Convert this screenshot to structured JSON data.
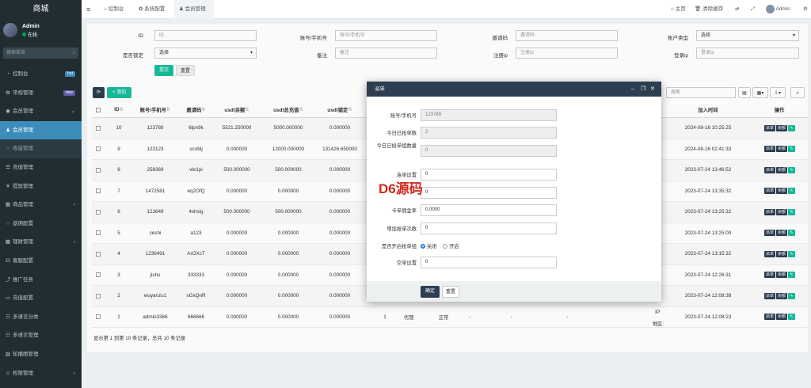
{
  "sidebar": {
    "brand": "商城",
    "user_name": "Admin",
    "status": "在线",
    "search_placeholder": "搜索菜单",
    "items": [
      {
        "label": "控制台",
        "icon": "dashboard-icon",
        "badge": "hot",
        "badge_color": "#3c8dbc"
      },
      {
        "label": "常规管理",
        "icon": "cog-icon",
        "badge": "new",
        "badge_color": "#605ca8"
      },
      {
        "label": "会员管理",
        "icon": "user-circle-icon",
        "arrow": "⌄"
      },
      {
        "label": "会员管理",
        "icon": "user-icon",
        "active": true
      },
      {
        "label": "收益管理",
        "icon": "circle-icon",
        "sub": true
      },
      {
        "label": "充值管理",
        "icon": "list-icon"
      },
      {
        "label": "提现管理",
        "icon": "yen-icon"
      },
      {
        "label": "商品管理",
        "icon": "table-icon",
        "arrow": "‹"
      },
      {
        "label": "返佣配置",
        "icon": "circle-icon"
      },
      {
        "label": "理财管理",
        "icon": "th-icon",
        "arrow": "‹"
      },
      {
        "label": "客服配置",
        "icon": "headset-icon"
      },
      {
        "label": "推广任务",
        "icon": "share-icon"
      },
      {
        "label": "充值配置",
        "icon": "card-icon"
      },
      {
        "label": "多语言分类",
        "icon": "language-icon"
      },
      {
        "label": "多语言管理",
        "icon": "language-icon"
      },
      {
        "label": "轮播图管理",
        "icon": "image-icon"
      },
      {
        "label": "权限管理",
        "icon": "group-icon",
        "arrow": "‹"
      }
    ]
  },
  "topbar": {
    "tabs": [
      "控制台",
      "系统配置",
      "会员管理"
    ],
    "right": [
      "主页",
      "清除缓存",
      "Admin"
    ]
  },
  "filters": {
    "id_label": "ID",
    "id_ph": "ID",
    "account_label": "账号/手机号",
    "account_ph": "账号/手机号",
    "invite_label": "邀请码",
    "invite_ph": "邀请码",
    "type_label": "账户类型",
    "type_value": "选择",
    "lock_label": "是否锁定",
    "lock_value": "选择",
    "remark_label": "备注",
    "remark_ph": "备注",
    "regip_label": "注册ip",
    "regip_ph": "注册ip",
    "loginip_label": "登录ip",
    "loginip_ph": "登录ip",
    "submit": "提交",
    "reset": "重置"
  },
  "toolbar": {
    "add": "添加",
    "search_ph": "搜索"
  },
  "table": {
    "headers": [
      "ID",
      "账号/手机号",
      "邀请码",
      "usdt余额",
      "usdt总充值",
      "usdt锁定",
      "加入时间",
      "操作"
    ],
    "rows": [
      {
        "id": "10",
        "acct": "123789",
        "inv": "6lpn9k",
        "bal": "5521.250000",
        "rech": "5000.000000",
        "lock": "0.000000",
        "time": "2024-08-16 10:25:25"
      },
      {
        "id": "9",
        "acct": "123123",
        "inv": "scofdj",
        "bal": "0.000000",
        "rech": "12000.000000",
        "lock": "131426.650000",
        "time": "2024-08-16 02:41:33"
      },
      {
        "id": "8",
        "acct": "258369",
        "inv": "vle1pi",
        "bal": "500.000000",
        "rech": "500.000000",
        "lock": "0.000000",
        "time": "2023-07-24 13:46:52"
      },
      {
        "id": "7",
        "acct": "1472581",
        "inv": "eq2OfQ",
        "bal": "0.000000",
        "rech": "0.000000",
        "lock": "0.000000",
        "time": "2023-07-24 13:35:32"
      },
      {
        "id": "6",
        "acct": "123649",
        "inv": "4xhsig",
        "bal": "500.000000",
        "rech": "500.000000",
        "lock": "0.000000",
        "time": "2023-07-24 13:25:32"
      },
      {
        "id": "5",
        "acct": "ceshi",
        "inv": "a123",
        "bal": "0.000000",
        "rech": "0.000000",
        "lock": "0.000000",
        "time": "2023-07-24 13:25:00"
      },
      {
        "id": "4",
        "acct": "1236491",
        "inv": "ArOXcT",
        "bal": "0.000000",
        "rech": "0.000000",
        "lock": "0.000000",
        "time": "2023-07-24 13:15:32"
      },
      {
        "id": "3",
        "acct": "jishu",
        "inv": "333333",
        "bal": "0.000000",
        "rech": "0.000000",
        "lock": "0.000000",
        "time": "2023-07-24 12:26:31"
      },
      {
        "id": "2",
        "acct": "wuyanzu1",
        "inv": "sGxQnR",
        "bal": "0.000000",
        "rech": "0.000000",
        "lock": "0.000000",
        "time": "2023-07-24 12:08:38"
      },
      {
        "id": "1",
        "acct": "admin3366",
        "inv": "666666",
        "bal": "0.000000",
        "rech": "0.000000",
        "lock": "0.000000",
        "time": "2023-07-24 12:08:23"
      }
    ],
    "last_row_extra": {
      "level": "1",
      "role": "代理",
      "status": "正常",
      "d1": "-",
      "d2": "-",
      "d3": "-",
      "ip": "IP:",
      "area": "地区:"
    },
    "action_labels": [
      "派单",
      "余额"
    ],
    "footer": "显示第 1 到第 10 条记录，总共 10 条记录"
  },
  "modal": {
    "title": "派单",
    "fields": [
      {
        "label": "账号/手机号",
        "value": "123789",
        "readonly": true
      },
      {
        "label": "今日已抢单数",
        "value": "2",
        "readonly": true
      },
      {
        "label": "今日已抢单组数量",
        "value": "0",
        "readonly": true
      },
      {
        "label": "连单设置",
        "value": "0"
      },
      {
        "label": "",
        "value": "0"
      },
      {
        "label": "卡单佣金率",
        "value": "0.0000"
      },
      {
        "label": "增加抢单次数",
        "value": "0"
      },
      {
        "label": "是否开启抢单组",
        "radio1": "关闭",
        "radio2": "开启"
      },
      {
        "label": "空单设置",
        "value": "0"
      }
    ],
    "confirm": "确定",
    "reset": "重置"
  },
  "watermark": "D6源码"
}
